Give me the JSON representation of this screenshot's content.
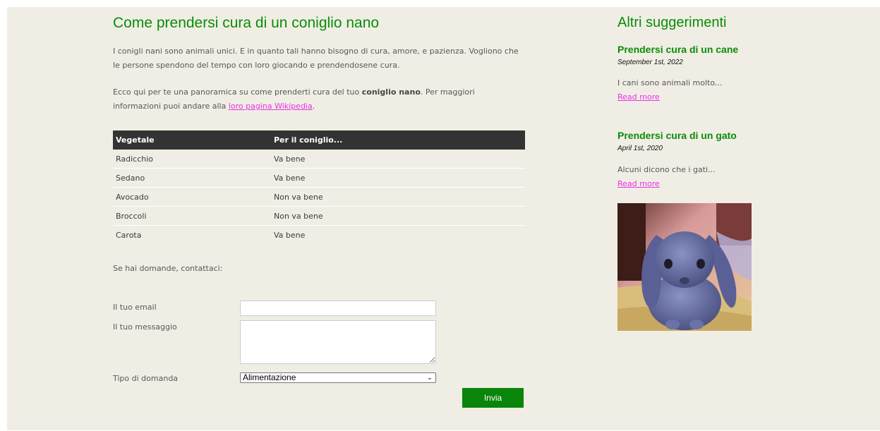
{
  "article": {
    "title": "Come prendersi cura di un coniglio nano",
    "intro": "I conigli nani sono animali unici. E in quanto tali hanno bisogno di cura, amore, e pazienza. Vogliono che le persone spendono del tempo con loro giocando e prendendosene cura.",
    "overview_before": "Ecco qui per te una panoramica su come prenderti cura del tuo ",
    "overview_bold": "coniglio nano",
    "overview_middle": ". Per maggiori informazioni puoi andare alla ",
    "overview_link": "loro pagina Wikipedia",
    "overview_end": "."
  },
  "table": {
    "headers": [
      "Vegetale",
      "Per il coniglio..."
    ],
    "rows": [
      [
        "Radicchio",
        "Va bene"
      ],
      [
        "Sedano",
        "Va bene"
      ],
      [
        "Avocado",
        "Non va bene"
      ],
      [
        "Broccoli",
        "Non va bene"
      ],
      [
        "Carota",
        "Va bene"
      ]
    ]
  },
  "contact": {
    "text": "Se hai domande, contattaci:",
    "email_label": "Il tuo email",
    "email_value": "",
    "message_label": "Il tuo messaggio",
    "message_value": "",
    "type_label": "Tipo di domanda",
    "type_selected": "Alimentazione",
    "submit_label": "Invia"
  },
  "sidebar": {
    "title": "Altri suggerimenti",
    "posts": [
      {
        "title": "Prendersi cura di un cane",
        "date": "September 1st, 2022",
        "excerpt": "I cani sono animali molto...",
        "link": "Read more"
      },
      {
        "title": "Prendersi cura di un gato",
        "date": "April 1st, 2020",
        "excerpt": "Alcuni dicono che i gati...",
        "link": "Read more"
      }
    ]
  },
  "colors": {
    "background": "#f0eee4",
    "heading": "#098c09",
    "link": "#e830e8",
    "table_header": "#333333",
    "button": "#098509"
  }
}
